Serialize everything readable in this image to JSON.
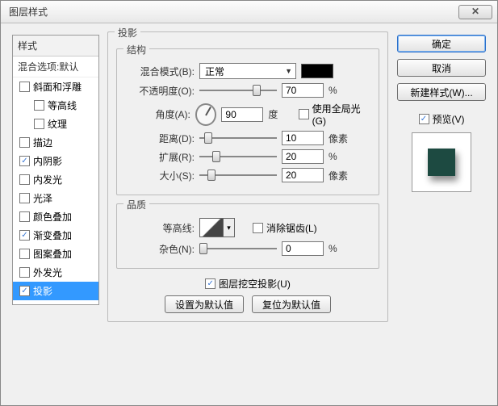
{
  "window": {
    "title": "图层样式"
  },
  "left": {
    "header": "样式",
    "subheader": "混合选项:默认",
    "items": [
      {
        "label": "斜面和浮雕",
        "checked": false,
        "indent": false,
        "selected": false
      },
      {
        "label": "等高线",
        "checked": false,
        "indent": true,
        "selected": false
      },
      {
        "label": "纹理",
        "checked": false,
        "indent": true,
        "selected": false
      },
      {
        "label": "描边",
        "checked": false,
        "indent": false,
        "selected": false
      },
      {
        "label": "内阴影",
        "checked": true,
        "indent": false,
        "selected": false
      },
      {
        "label": "内发光",
        "checked": false,
        "indent": false,
        "selected": false
      },
      {
        "label": "光泽",
        "checked": false,
        "indent": false,
        "selected": false
      },
      {
        "label": "颜色叠加",
        "checked": false,
        "indent": false,
        "selected": false
      },
      {
        "label": "渐变叠加",
        "checked": true,
        "indent": false,
        "selected": false
      },
      {
        "label": "图案叠加",
        "checked": false,
        "indent": false,
        "selected": false
      },
      {
        "label": "外发光",
        "checked": false,
        "indent": false,
        "selected": false
      },
      {
        "label": "投影",
        "checked": true,
        "indent": false,
        "selected": true
      }
    ]
  },
  "mid": {
    "title": "投影",
    "structure_title": "结构",
    "blend_label": "混合模式(B):",
    "blend_value": "正常",
    "swatch_color": "#000000",
    "opacity_label": "不透明度(O):",
    "opacity_value": "70",
    "opacity_unit": "%",
    "angle_label": "角度(A):",
    "angle_value": "90",
    "angle_unit": "度",
    "global_light_label": "使用全局光(G)",
    "global_light_checked": false,
    "distance_label": "距离(D):",
    "distance_value": "10",
    "distance_unit": "像素",
    "spread_label": "扩展(R):",
    "spread_value": "20",
    "spread_unit": "%",
    "size_label": "大小(S):",
    "size_value": "20",
    "size_unit": "像素",
    "quality_title": "品质",
    "contour_label": "等高线:",
    "antialias_label": "消除锯齿(L)",
    "antialias_checked": false,
    "noise_label": "杂色(N):",
    "noise_value": "0",
    "noise_unit": "%",
    "knockout_label": "图层挖空投影(U)",
    "knockout_checked": true,
    "btn_default": "设置为默认值",
    "btn_reset": "复位为默认值"
  },
  "right": {
    "ok": "确定",
    "cancel": "取消",
    "newstyle": "新建样式(W)...",
    "preview_label": "预览(V)",
    "preview_checked": true
  }
}
